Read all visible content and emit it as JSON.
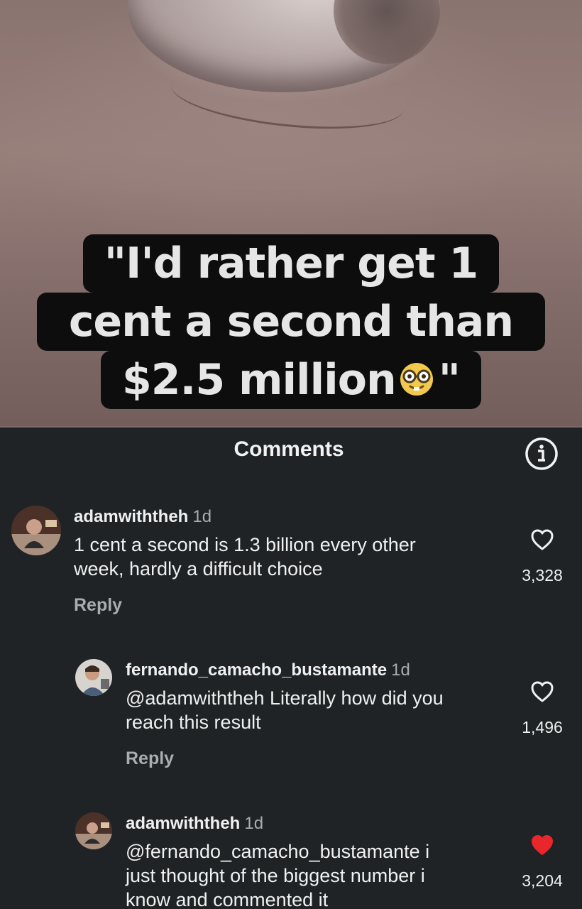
{
  "video": {
    "caption_lines": [
      "\"I'd rather get 1",
      "cent a second than",
      "$2.5 million",
      "\""
    ],
    "caption_emoji": "nerd-face-icon"
  },
  "panel": {
    "title": "Comments",
    "info_icon": "info-icon"
  },
  "comments": [
    {
      "username": "adamwiththeh",
      "time": "1d",
      "text_lines": [
        "1 cent a second is 1.3 billion every other",
        "week, hardly a difficult choice"
      ],
      "reply_label": "Reply",
      "like_count": "3,328",
      "liked": false
    },
    {
      "username": "fernando_camacho_bustamante",
      "time": "1d",
      "text_lines": [
        "@adamwiththeh Literally how did you",
        "reach this result"
      ],
      "reply_label": "Reply",
      "like_count": "1,496",
      "liked": false
    },
    {
      "username": "adamwiththeh",
      "time": "1d",
      "text_lines": [
        "@fernando_camacho_bustamante i",
        "just thought of the biggest number i",
        "know and commented it"
      ],
      "like_count": "3,204",
      "liked": true
    }
  ],
  "colors": {
    "panel_bg": "#1f2326",
    "liked_heart": "#e8262b",
    "muted_text": "#a9adb0"
  }
}
